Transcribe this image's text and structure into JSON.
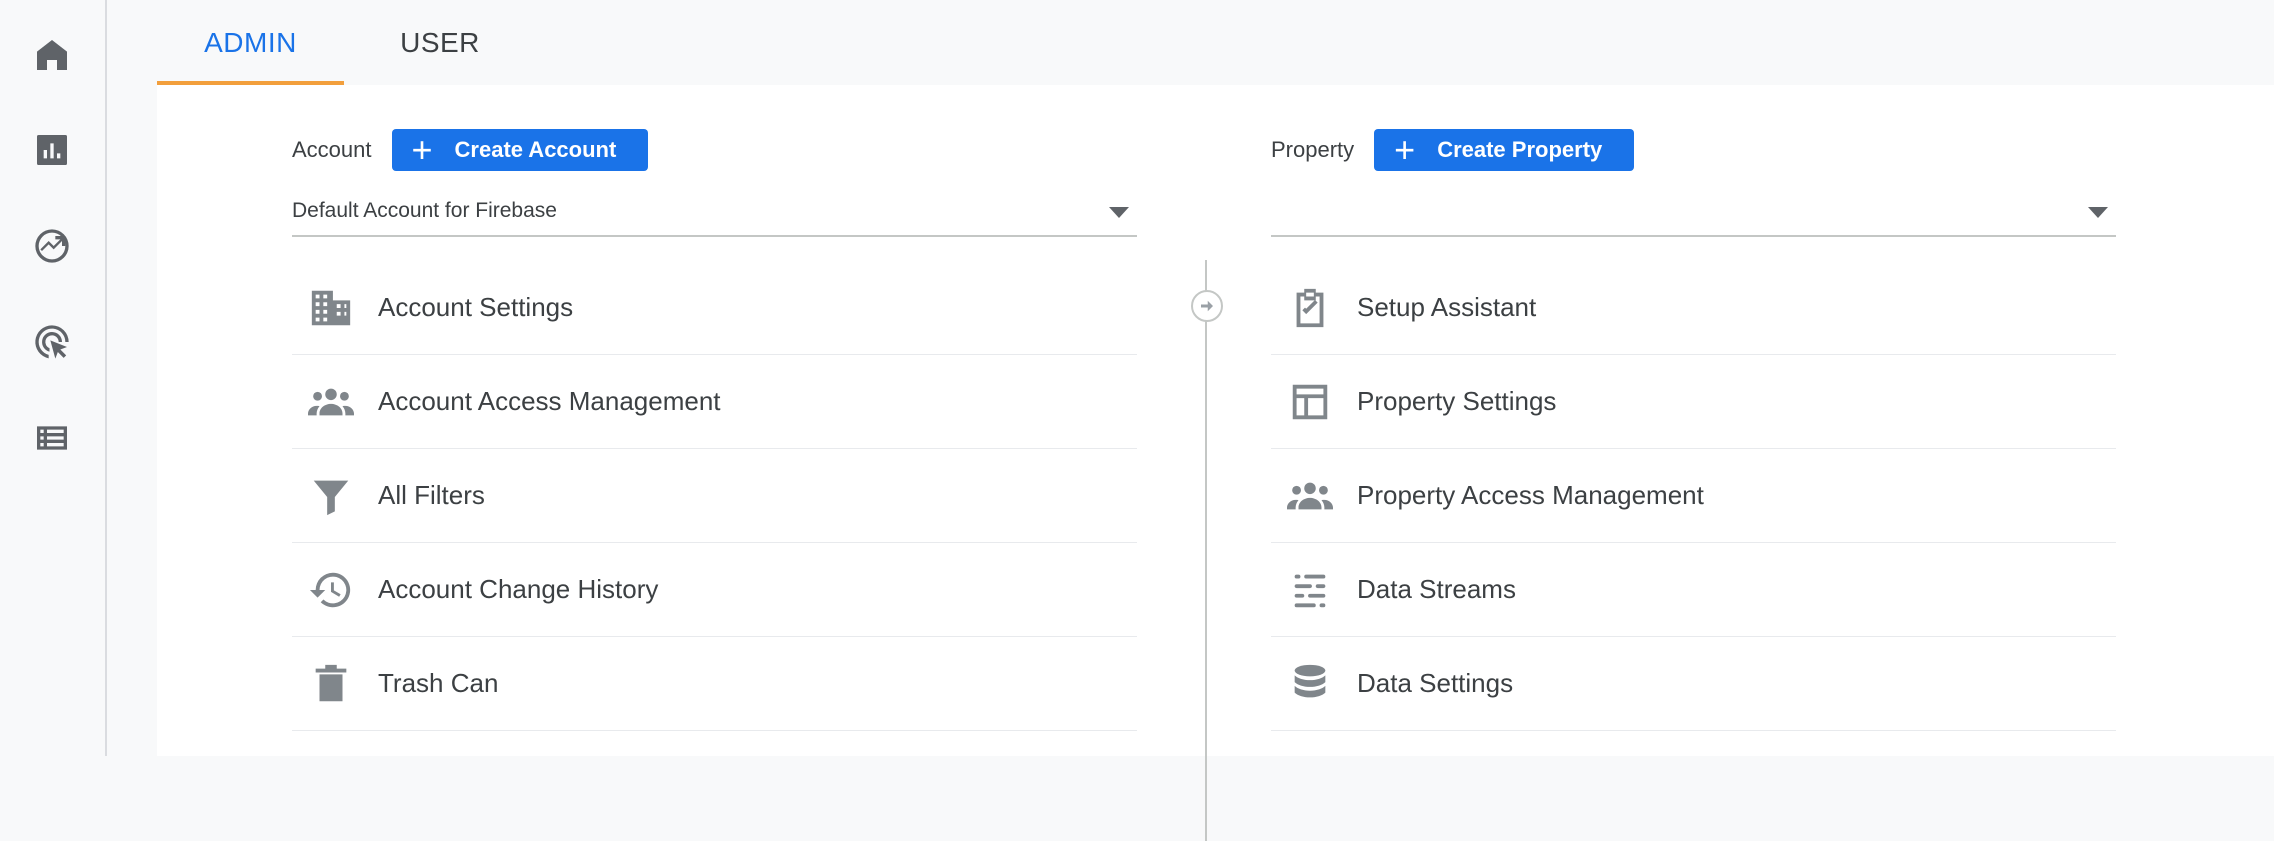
{
  "sidebar": {
    "items": [
      {
        "icon": "home-icon"
      },
      {
        "icon": "reports-icon"
      },
      {
        "icon": "explore-icon"
      },
      {
        "icon": "advertising-icon"
      },
      {
        "icon": "configure-icon"
      }
    ]
  },
  "tabs": {
    "admin": "ADMIN",
    "user": "USER"
  },
  "account": {
    "label": "Account",
    "create_label": "Create Account",
    "selected": "Default Account for Firebase",
    "items": [
      {
        "label": "Account Settings",
        "icon": "building-icon"
      },
      {
        "label": "Account Access Management",
        "icon": "people-icon"
      },
      {
        "label": "All Filters",
        "icon": "filter-icon"
      },
      {
        "label": "Account Change History",
        "icon": "history-icon"
      },
      {
        "label": "Trash Can",
        "icon": "trash-icon"
      }
    ]
  },
  "property": {
    "label": "Property",
    "create_label": "Create Property",
    "selected": "",
    "items": [
      {
        "label": "Setup Assistant",
        "icon": "checklist-icon"
      },
      {
        "label": "Property Settings",
        "icon": "layout-icon"
      },
      {
        "label": "Property Access Management",
        "icon": "people-icon"
      },
      {
        "label": "Data Streams",
        "icon": "streams-icon"
      },
      {
        "label": "Data Settings",
        "icon": "database-icon"
      }
    ]
  },
  "colors": {
    "accent": "#1a73e8",
    "tab_underline": "#f29f3c",
    "icon": "#80868b"
  }
}
